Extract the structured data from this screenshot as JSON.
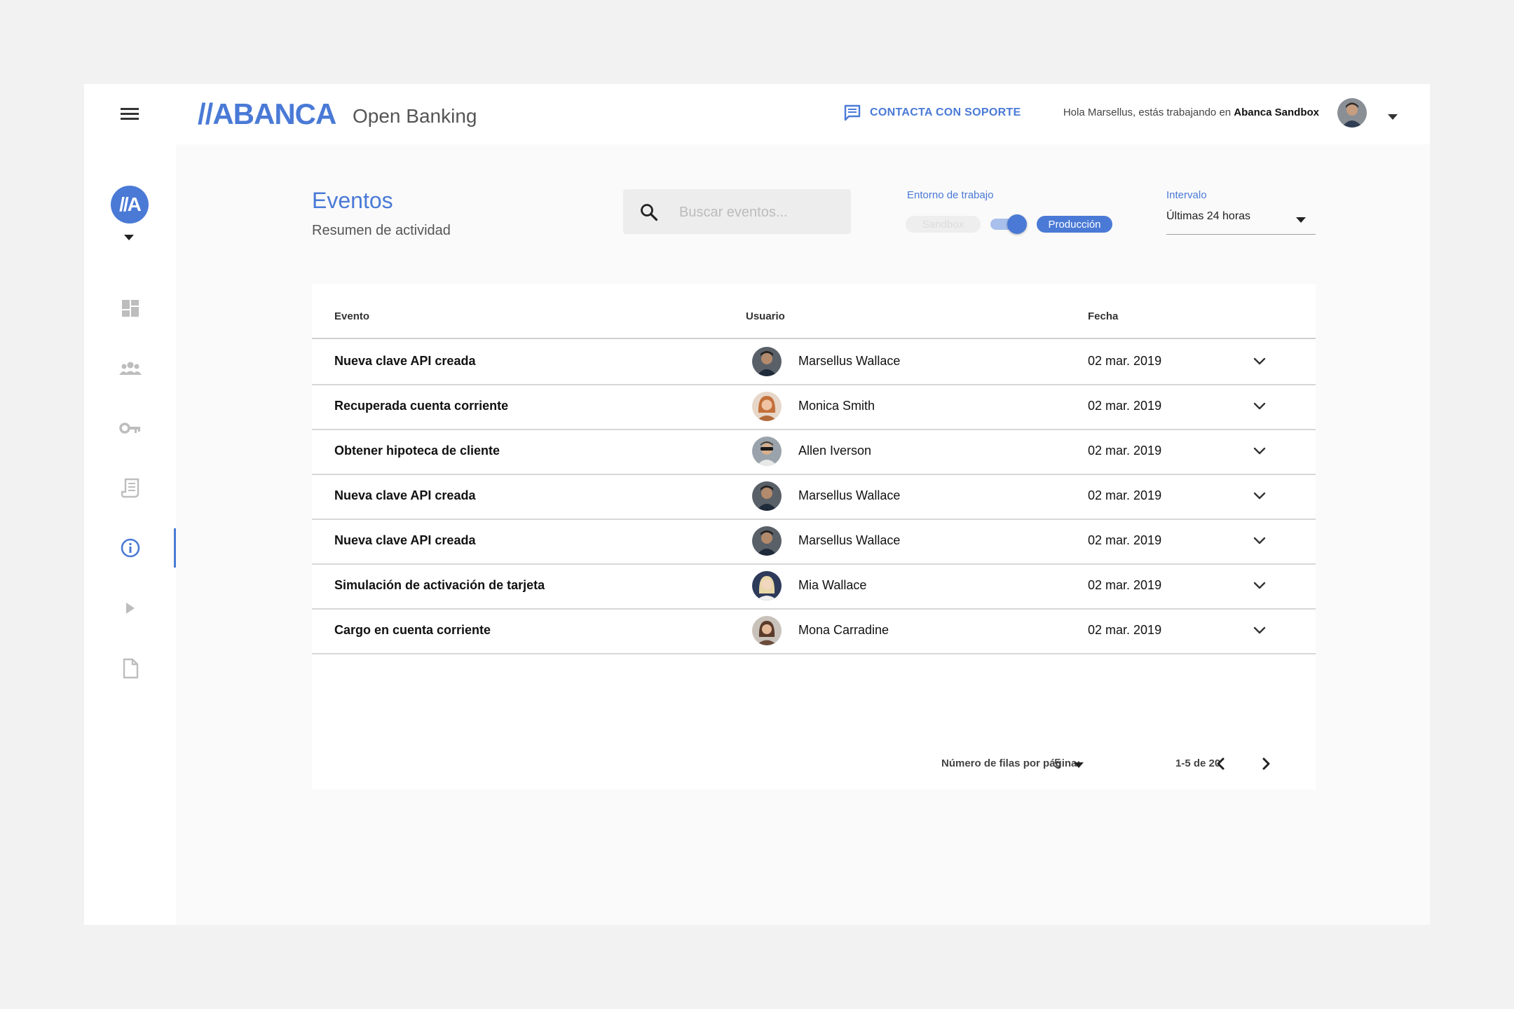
{
  "header": {
    "brand": "//ABANCA",
    "product": "Open Banking",
    "support_label": "CONTACTA CON SOPORTE",
    "greeting_prefix": "Hola Marsellus, estás trabajando en",
    "workspace": "Abanca Sandbox"
  },
  "sidebar": {
    "brand_initials": "//A",
    "items": [
      {
        "icon": "dashboard-icon"
      },
      {
        "icon": "users-icon"
      },
      {
        "icon": "key-icon"
      },
      {
        "icon": "receipt-icon"
      },
      {
        "icon": "info-icon",
        "active": true
      },
      {
        "icon": "play-icon"
      },
      {
        "icon": "document-icon"
      }
    ]
  },
  "page": {
    "title": "Eventos",
    "subtitle": "Resumen de actividad"
  },
  "search": {
    "placeholder": "Buscar eventos...",
    "value": ""
  },
  "environment": {
    "label": "Entorno de trabajo",
    "option_off": "Sandbox",
    "option_on": "Producción",
    "selected": "Producción"
  },
  "interval": {
    "label": "Intervalo",
    "value": "Últimas 24 horas"
  },
  "table": {
    "columns": [
      "Evento",
      "Usuario",
      "Fecha"
    ],
    "rows": [
      {
        "event": "Nueva clave API creada",
        "user": "Marsellus Wallace",
        "date": "02 mar. 2019"
      },
      {
        "event": "Recuperada cuenta corriente",
        "user": "Monica Smith",
        "date": "02 mar. 2019"
      },
      {
        "event": "Obtener hipoteca de cliente",
        "user": "Allen Iverson",
        "date": "02 mar. 2019"
      },
      {
        "event": "Nueva clave API creada",
        "user": "Marsellus Wallace",
        "date": "02 mar. 2019"
      },
      {
        "event": "Nueva clave API creada",
        "user": "Marsellus Wallace",
        "date": "02 mar. 2019"
      },
      {
        "event": "Simulación de activación de tarjeta",
        "user": "Mia Wallace",
        "date": "02 mar. 2019"
      },
      {
        "event": "Cargo en cuenta corriente",
        "user": "Mona Carradine",
        "date": "02 mar. 2019"
      }
    ]
  },
  "pagination": {
    "rows_label": "Número de filas por página:",
    "rows_per_page": "5",
    "range": "1-5 de 20"
  },
  "colors": {
    "accent": "#4a7ad6",
    "background": "#f2f2f2",
    "panel": "#fafafa",
    "white": "#ffffff"
  }
}
